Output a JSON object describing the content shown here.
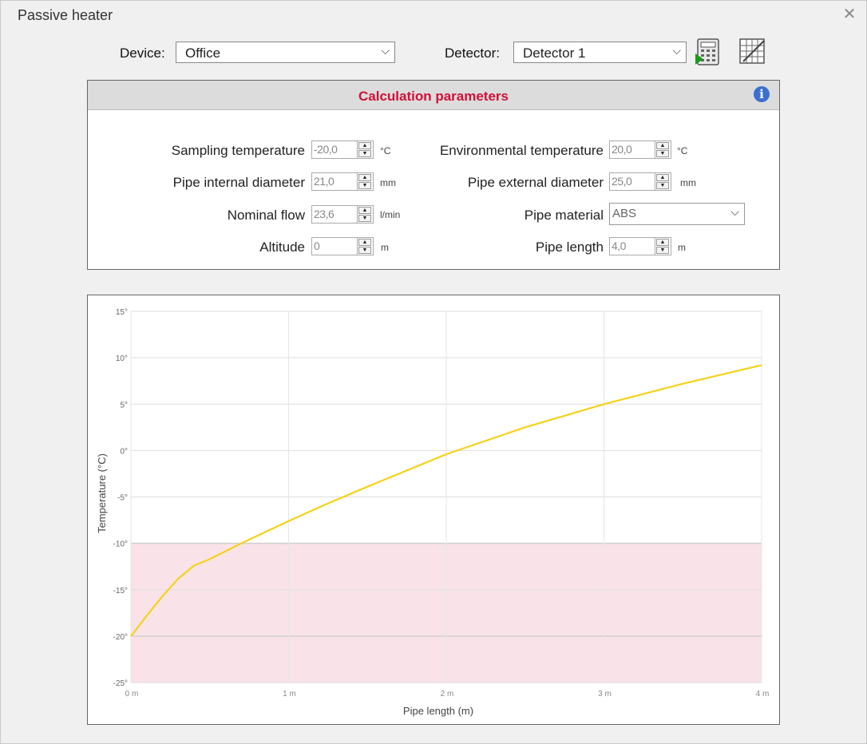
{
  "window": {
    "title": "Passive heater"
  },
  "toolbar": {
    "device_label": "Device:",
    "device_value": "Office",
    "detector_label": "Detector:",
    "detector_value": "Detector 1",
    "calc_button_icon": "calculator-icon",
    "table_button_icon": "table-grid-icon"
  },
  "params": {
    "title": "Calculation parameters",
    "info_icon": "info-icon",
    "sampling_temperature": {
      "label": "Sampling temperature",
      "value": "-20,0",
      "unit": "°C"
    },
    "environmental_temperature": {
      "label": "Environmental temperature",
      "value": "20,0",
      "unit": "°C"
    },
    "pipe_internal_diameter": {
      "label": "Pipe internal diameter",
      "value": "21,0",
      "unit": "mm"
    },
    "pipe_external_diameter": {
      "label": "Pipe external diameter",
      "value": "25,0",
      "unit": "mm"
    },
    "nominal_flow": {
      "label": "Nominal flow",
      "value": "23,6",
      "unit": "l/min"
    },
    "pipe_material": {
      "label": "Pipe material",
      "value": "ABS"
    },
    "altitude": {
      "label": "Altitude",
      "value": "0",
      "unit": "m"
    },
    "pipe_length": {
      "label": "Pipe length",
      "value": "4,0",
      "unit": "m"
    }
  },
  "chart_data": {
    "type": "line",
    "xlabel": "Pipe length (m)",
    "ylabel": "Temperature (°C)",
    "xlim": [
      0,
      4
    ],
    "ylim": [
      -25,
      15
    ],
    "x_ticks": [
      0,
      1,
      2,
      3,
      4
    ],
    "x_tick_labels": [
      "0 m",
      "1 m",
      "2 m",
      "3 m",
      "4 m"
    ],
    "y_ticks": [
      15,
      10,
      5,
      0,
      -5,
      -10,
      -15,
      -20,
      -25
    ],
    "y_tick_labels": [
      "15°",
      "10°",
      "5°",
      "0°",
      "-5°",
      "-10°",
      "-15°",
      "-20°",
      "-25°"
    ],
    "grid": true,
    "band": {
      "from": -25,
      "to": -10,
      "color": "#fae3e8"
    },
    "series": [
      {
        "color": "#f5d21a",
        "x": [
          0,
          0.1,
          0.2,
          0.3,
          0.4,
          0.5,
          0.7,
          1.0,
          1.25,
          1.5,
          2.0,
          2.5,
          3.0,
          3.5,
          4.0
        ],
        "y": [
          -20.0,
          -17.8,
          -15.7,
          -13.8,
          -12.4,
          -11.7,
          -10.0,
          -7.6,
          -5.7,
          -3.9,
          -0.4,
          2.5,
          5.0,
          7.2,
          9.2
        ]
      }
    ]
  }
}
